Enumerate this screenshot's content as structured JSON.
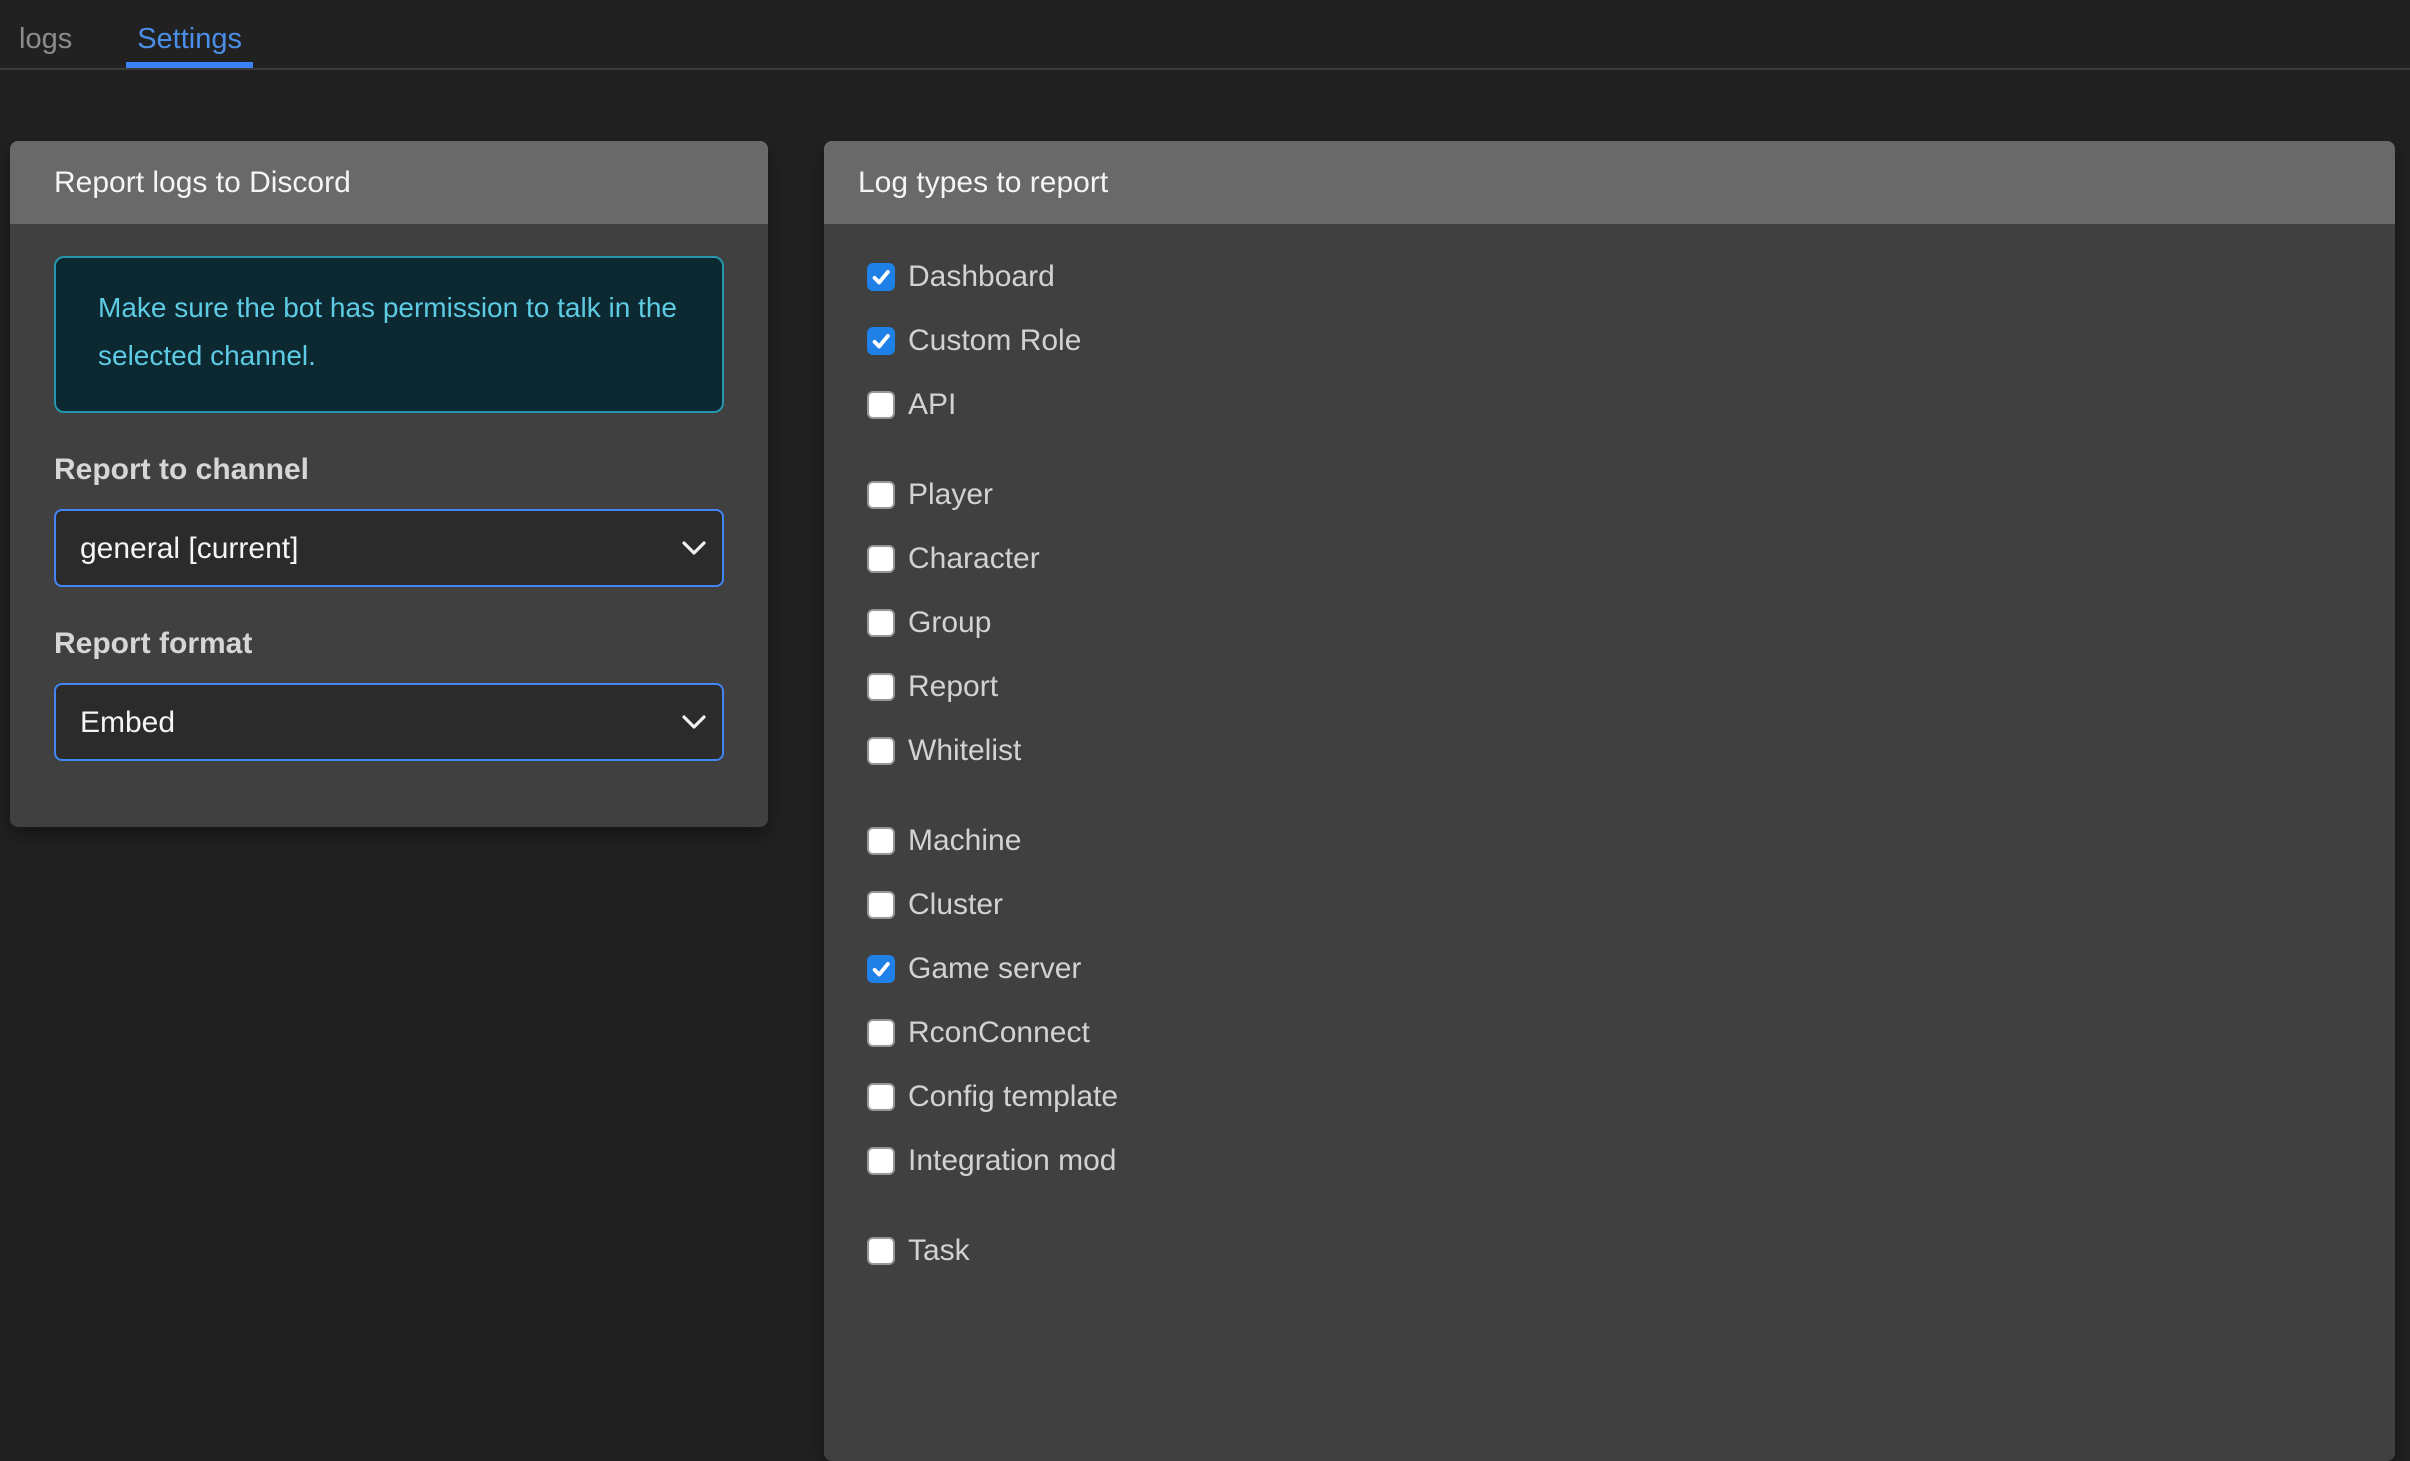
{
  "tabs": [
    {
      "label": "logs",
      "active": false
    },
    {
      "label": "Settings",
      "active": true
    }
  ],
  "left_panel": {
    "title": "Report logs to Discord",
    "notice": "Make sure the bot has permission to talk in the selected channel.",
    "channel_field": {
      "label": "Report to channel",
      "value": "general [current]"
    },
    "format_field": {
      "label": "Report format",
      "value": "Embed"
    }
  },
  "right_panel": {
    "title": "Log types to report",
    "groups": [
      {
        "items": [
          {
            "label": "Dashboard",
            "checked": true
          },
          {
            "label": "Custom Role",
            "checked": true
          },
          {
            "label": "API",
            "checked": false
          }
        ]
      },
      {
        "items": [
          {
            "label": "Player",
            "checked": false
          },
          {
            "label": "Character",
            "checked": false
          },
          {
            "label": "Group",
            "checked": false
          },
          {
            "label": "Report",
            "checked": false
          },
          {
            "label": "Whitelist",
            "checked": false
          }
        ]
      },
      {
        "items": [
          {
            "label": "Machine",
            "checked": false
          },
          {
            "label": "Cluster",
            "checked": false
          },
          {
            "label": "Game server",
            "checked": true
          },
          {
            "label": "RconConnect",
            "checked": false
          },
          {
            "label": "Config template",
            "checked": false
          },
          {
            "label": "Integration mod",
            "checked": false
          }
        ]
      },
      {
        "items": [
          {
            "label": "Task",
            "checked": false
          }
        ]
      }
    ]
  },
  "colors": {
    "accent_blue": "#4285f4",
    "active_tab_text": "#4a8ee8",
    "checkbox_checked": "#1f80e8",
    "notice_border": "#2596ad",
    "notice_background": "#0c2830",
    "notice_text": "#5ecbe4",
    "panel_header": "#696969",
    "panel_body": "#404040",
    "page_background": "#212121"
  }
}
